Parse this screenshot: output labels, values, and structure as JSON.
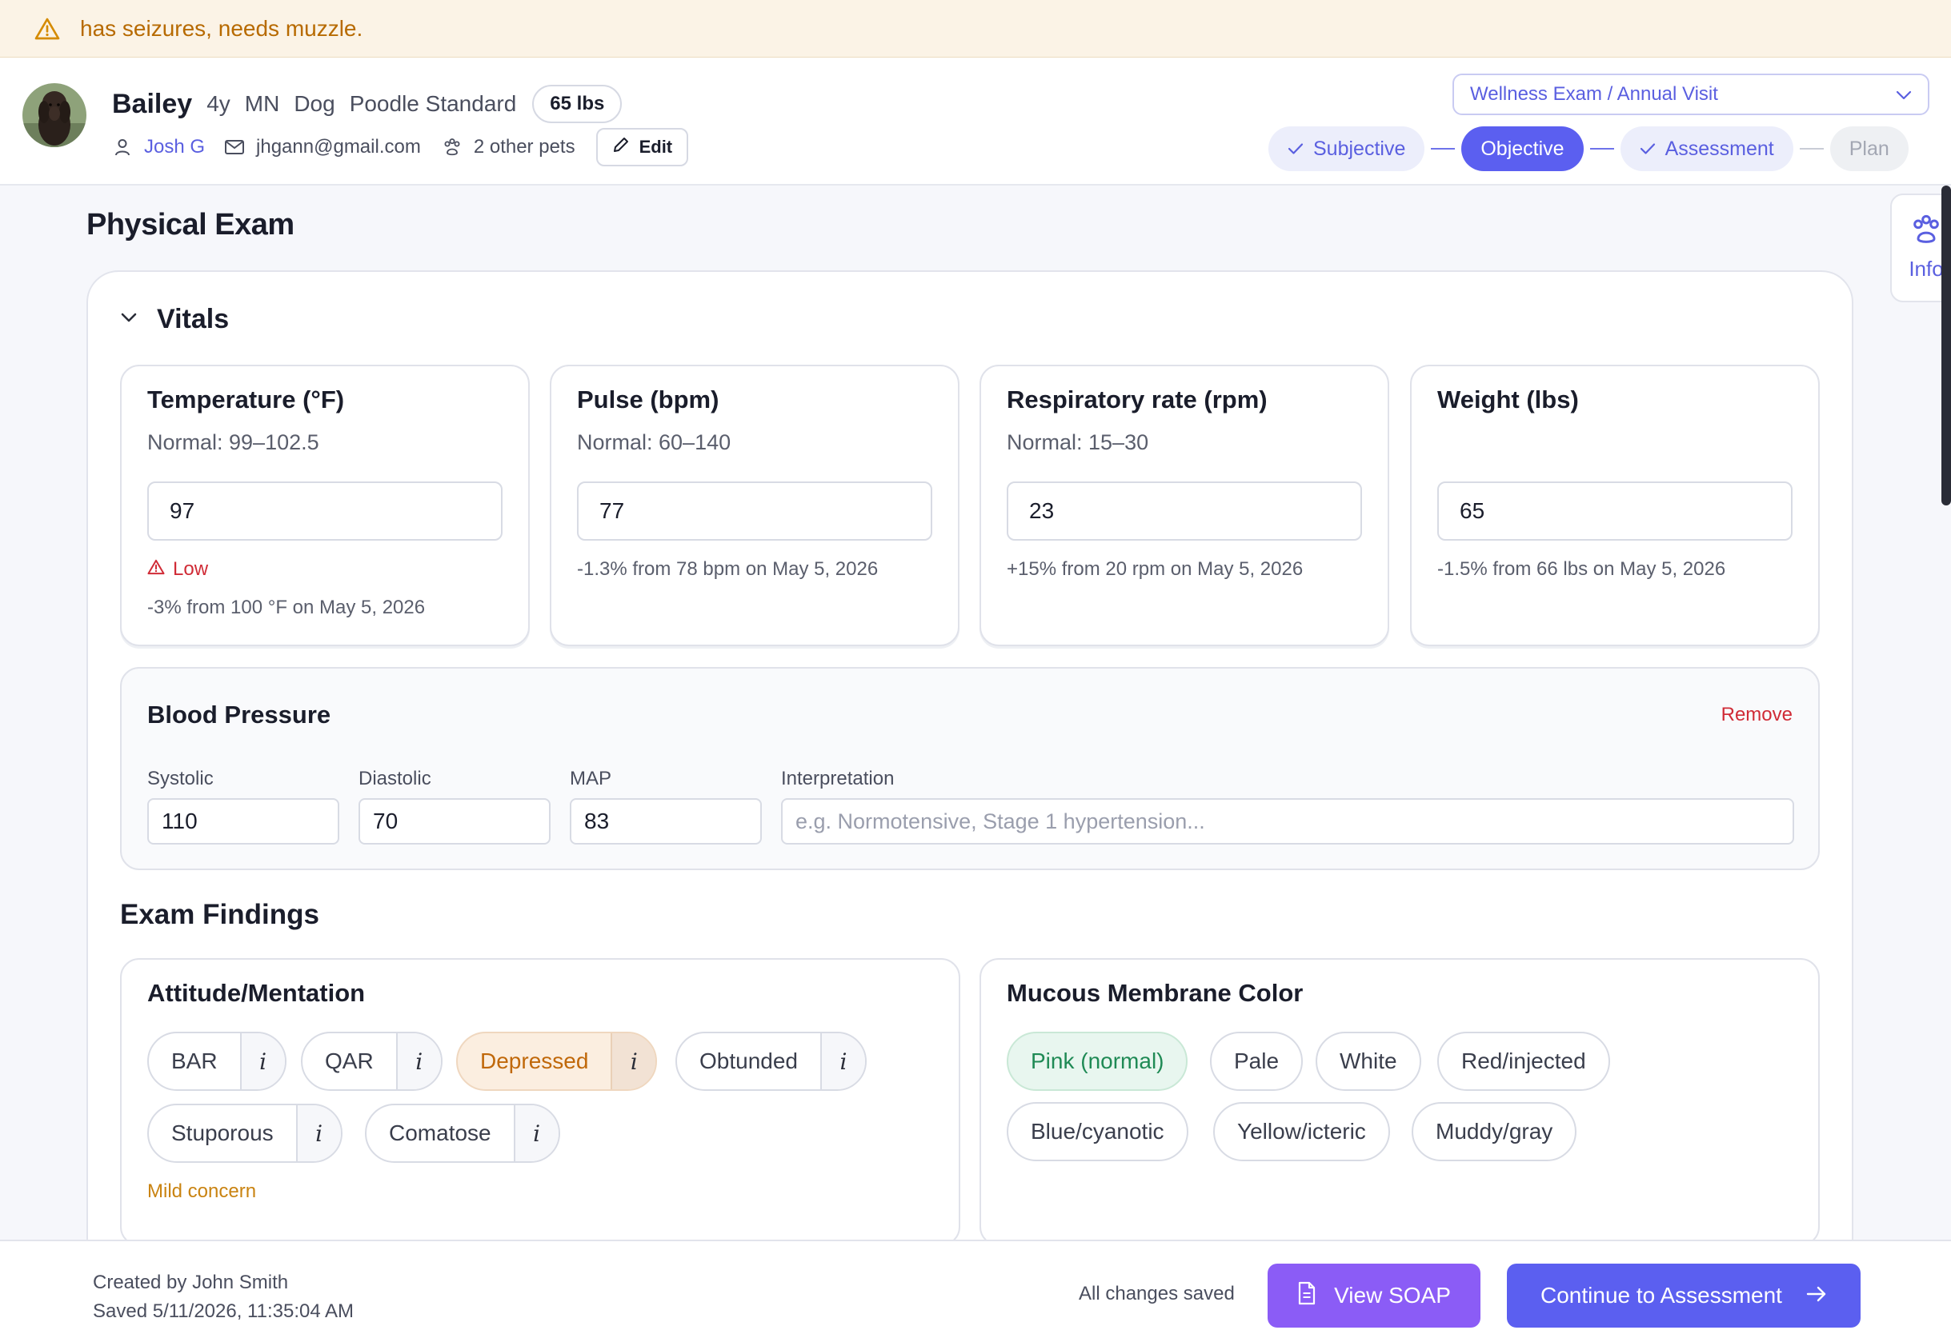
{
  "alert": {
    "text": "has seizures, needs muzzle."
  },
  "patient": {
    "name": "Bailey",
    "age": "4y",
    "sex": "MN",
    "species": "Dog",
    "breed": "Poodle Standard",
    "weight": "65 lbs",
    "owner": "Josh G",
    "email": "jhgann@gmail.com",
    "other_pets": "2 other pets",
    "edit_label": "Edit"
  },
  "visit": {
    "type": "Wellness Exam / Annual Visit",
    "steps": [
      {
        "label": "Subjective",
        "state": "done"
      },
      {
        "label": "Objective",
        "state": "active"
      },
      {
        "label": "Assessment",
        "state": "done"
      },
      {
        "label": "Plan",
        "state": "todo"
      }
    ]
  },
  "info_tab": {
    "label": "Info"
  },
  "page": {
    "title": "Physical Exam"
  },
  "vitals": {
    "title": "Vitals",
    "cards": [
      {
        "title": "Temperature (°F)",
        "normal": "Normal: 99–102.5",
        "value": "97",
        "flag": "Low",
        "delta": "-3% from 100 °F on May 5, 2026"
      },
      {
        "title": "Pulse (bpm)",
        "normal": "Normal: 60–140",
        "value": "77",
        "delta": "-1.3% from 78 bpm on May 5, 2026"
      },
      {
        "title": "Respiratory rate (rpm)",
        "normal": "Normal: 15–30",
        "value": "23",
        "delta": "+15% from 20 rpm on May 5, 2026"
      },
      {
        "title": "Weight (lbs)",
        "normal": "",
        "value": "65",
        "delta": "-1.5% from 66 lbs on May 5, 2026"
      }
    ]
  },
  "blood_pressure": {
    "title": "Blood Pressure",
    "remove_label": "Remove",
    "systolic_label": "Systolic",
    "systolic": "110",
    "diastolic_label": "Diastolic",
    "diastolic": "70",
    "map_label": "MAP",
    "map": "83",
    "interpretation_label": "Interpretation",
    "interpretation_placeholder": "e.g. Normotensive, Stage 1 hypertension..."
  },
  "findings": {
    "title": "Exam Findings",
    "attitude": {
      "title": "Attitude/Mentation",
      "options": [
        "BAR",
        "QAR",
        "Depressed",
        "Obtunded",
        "Stuporous",
        "Comatose"
      ],
      "selected": "Depressed",
      "info_glyph": "i",
      "note": "Mild concern"
    },
    "mucous": {
      "title": "Mucous Membrane Color",
      "options": [
        "Pink (normal)",
        "Pale",
        "White",
        "Red/injected",
        "Blue/cyanotic",
        "Yellow/icteric",
        "Muddy/gray"
      ],
      "selected": "Pink (normal)"
    }
  },
  "footer": {
    "created_by": "Created by John Smith",
    "saved_at": "Saved 5/11/2026, 11:35:04 AM",
    "status": "All changes saved",
    "view_soap": "View SOAP",
    "continue": "Continue to Assessment"
  },
  "colors": {
    "accent": "#5b5ff0",
    "soap": "#8b5cf6",
    "danger": "#d02b36",
    "warning": "#c98311",
    "success": "#1f8a55"
  }
}
